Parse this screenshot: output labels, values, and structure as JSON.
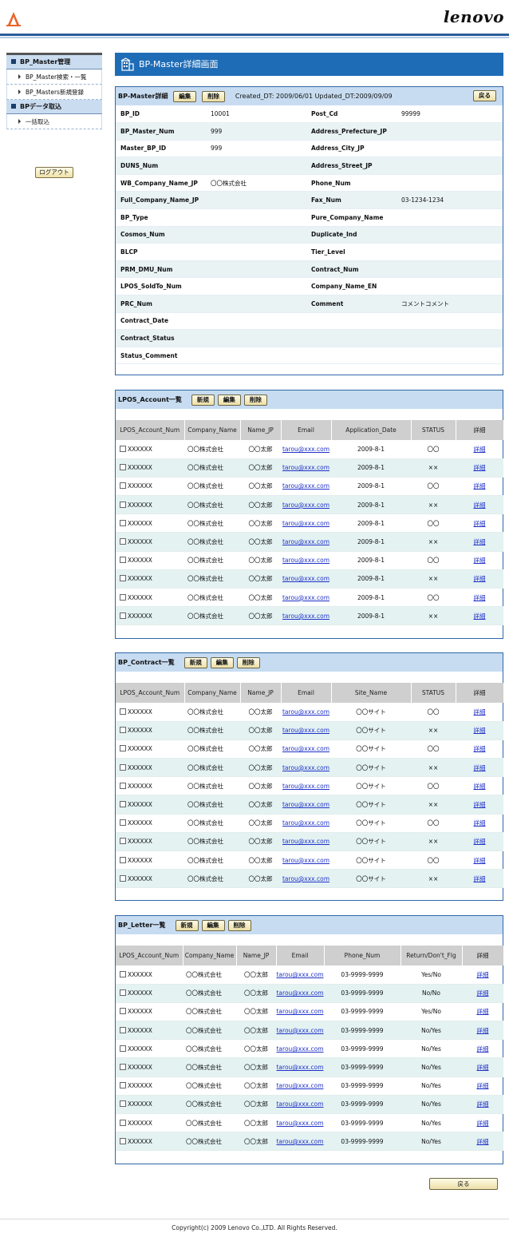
{
  "header": {
    "brand": "lenovo"
  },
  "sidebar": {
    "sections": [
      {
        "title": "BP_Master管理",
        "items": [
          "BP_Master検索・一覧",
          "BP_Masters新規登録"
        ]
      },
      {
        "title": "BPデータ取込",
        "items": [
          "一括取込"
        ]
      }
    ],
    "logout_label": "ログアウト"
  },
  "page_title": "BP-Master詳細画面",
  "detail": {
    "title": "BP-Master詳細",
    "edit_label": "編集",
    "delete_label": "削除",
    "meta": "Created_DT: 2009/06/01  Updated_DT:2009/09/09",
    "back_label": "戻る",
    "rows": [
      {
        "l1": "BP_ID",
        "v1": "10001",
        "l2": "Post_Cd",
        "v2": "99999"
      },
      {
        "l1": "BP_Master_Num",
        "v1": "999",
        "l2": "Address_Prefecture_JP",
        "v2": ""
      },
      {
        "l1": "Master_BP_ID",
        "v1": "999",
        "l2": "Address_City_JP",
        "v2": ""
      },
      {
        "l1": "DUNS_Num",
        "v1": "",
        "l2": "Address_Street_JP",
        "v2": ""
      },
      {
        "l1": "WB_Company_Name_JP",
        "v1": "〇〇株式会社",
        "l2": "Phone_Num",
        "v2": ""
      },
      {
        "l1": "Full_Company_Name_JP",
        "v1": "",
        "l2": "Fax_Num",
        "v2": "03-1234-1234"
      },
      {
        "l1": "BP_Type",
        "v1": "",
        "l2": "Pure_Company_Name",
        "v2": ""
      },
      {
        "l1": "Cosmos_Num",
        "v1": "",
        "l2": "Duplicate_Ind",
        "v2": ""
      },
      {
        "l1": "BLCP",
        "v1": "",
        "l2": "Tier_Level",
        "v2": ""
      },
      {
        "l1": "PRM_DMU_Num",
        "v1": "",
        "l2": "Contract_Num",
        "v2": ""
      },
      {
        "l1": "LPOS_SoldTo_Num",
        "v1": "",
        "l2": "Company_Name_EN",
        "v2": ""
      },
      {
        "l1": "PRC_Num",
        "v1": "",
        "l2": "Comment",
        "v2": "コメントコメント"
      },
      {
        "l1": "Contract_Date",
        "v1": "",
        "l2": "",
        "v2": ""
      },
      {
        "l1": "Contract_Status",
        "v1": "",
        "l2": "",
        "v2": ""
      },
      {
        "l1": "Status_Comment",
        "v1": "",
        "l2": "",
        "v2": ""
      }
    ]
  },
  "lists": [
    {
      "title": "LPOS_Account一覧",
      "buttons": [
        "新規",
        "編集",
        "削除"
      ],
      "columns": [
        "LPOS_Account_Num",
        "Company_Name",
        "Name_JP",
        "Email",
        "Application_Date",
        "STATUS",
        "詳細"
      ],
      "widths": [
        86,
        70,
        51,
        63,
        100,
        56,
        60
      ],
      "rows": [
        [
          "XXXXXX",
          "〇〇株式会社",
          "〇〇太郎",
          "tarou@xxx.com",
          "2009-8-1",
          "〇〇",
          "詳細"
        ],
        [
          "XXXXXX",
          "〇〇株式会社",
          "〇〇太郎",
          "tarou@xxx.com",
          "2009-8-1",
          "××",
          "詳細"
        ],
        [
          "XXXXXX",
          "〇〇株式会社",
          "〇〇太郎",
          "tarou@xxx.com",
          "2009-8-1",
          "〇〇",
          "詳細"
        ],
        [
          "XXXXXX",
          "〇〇株式会社",
          "〇〇太郎",
          "tarou@xxx.com",
          "2009-8-1",
          "××",
          "詳細"
        ],
        [
          "XXXXXX",
          "〇〇株式会社",
          "〇〇太郎",
          "tarou@xxx.com",
          "2009-8-1",
          "〇〇",
          "詳細"
        ],
        [
          "XXXXXX",
          "〇〇株式会社",
          "〇〇太郎",
          "tarou@xxx.com",
          "2009-8-1",
          "××",
          "詳細"
        ],
        [
          "XXXXXX",
          "〇〇株式会社",
          "〇〇太郎",
          "tarou@xxx.com",
          "2009-8-1",
          "〇〇",
          "詳細"
        ],
        [
          "XXXXXX",
          "〇〇株式会社",
          "〇〇太郎",
          "tarou@xxx.com",
          "2009-8-1",
          "××",
          "詳細"
        ],
        [
          "XXXXXX",
          "〇〇株式会社",
          "〇〇太郎",
          "tarou@xxx.com",
          "2009-8-1",
          "〇〇",
          "詳細"
        ],
        [
          "XXXXXX",
          "〇〇株式会社",
          "〇〇太郎",
          "tarou@xxx.com",
          "2009-8-1",
          "××",
          "詳細"
        ]
      ]
    },
    {
      "title": "BP_Contract一覧",
      "buttons": [
        "新規",
        "編集",
        "削除"
      ],
      "columns": [
        "LPOS_Account_Num",
        "Company_Name",
        "Name_JP",
        "Email",
        "Site_Name",
        "STATUS",
        "詳細"
      ],
      "widths": [
        86,
        70,
        51,
        63,
        100,
        56,
        60
      ],
      "rows": [
        [
          "XXXXXX",
          "〇〇株式会社",
          "〇〇太郎",
          "tarou@xxx.com",
          "〇〇サイト",
          "〇〇",
          "詳細"
        ],
        [
          "XXXXXX",
          "〇〇株式会社",
          "〇〇太郎",
          "tarou@xxx.com",
          "〇〇サイト",
          "××",
          "詳細"
        ],
        [
          "XXXXXX",
          "〇〇株式会社",
          "〇〇太郎",
          "tarou@xxx.com",
          "〇〇サイト",
          "〇〇",
          "詳細"
        ],
        [
          "XXXXXX",
          "〇〇株式会社",
          "〇〇太郎",
          "tarou@xxx.com",
          "〇〇サイト",
          "××",
          "詳細"
        ],
        [
          "XXXXXX",
          "〇〇株式会社",
          "〇〇太郎",
          "tarou@xxx.com",
          "〇〇サイト",
          "〇〇",
          "詳細"
        ],
        [
          "XXXXXX",
          "〇〇株式会社",
          "〇〇太郎",
          "tarou@xxx.com",
          "〇〇サイト",
          "××",
          "詳細"
        ],
        [
          "XXXXXX",
          "〇〇株式会社",
          "〇〇太郎",
          "tarou@xxx.com",
          "〇〇サイト",
          "〇〇",
          "詳細"
        ],
        [
          "XXXXXX",
          "〇〇株式会社",
          "〇〇太郎",
          "tarou@xxx.com",
          "〇〇サイト",
          "××",
          "詳細"
        ],
        [
          "XXXXXX",
          "〇〇株式会社",
          "〇〇太郎",
          "tarou@xxx.com",
          "〇〇サイト",
          "〇〇",
          "詳細"
        ],
        [
          "XXXXXX",
          "〇〇株式会社",
          "〇〇太郎",
          "tarou@xxx.com",
          "〇〇サイト",
          "××",
          "詳細"
        ]
      ]
    },
    {
      "title": "BP_Letter一覧",
      "buttons": [
        "新規",
        "編集",
        "削除"
      ],
      "columns": [
        "LPOS_Account_Num",
        "Company_Name",
        "Name_JP",
        "Email",
        "Phone_Num",
        "Return/Don't_Flg",
        "詳細"
      ],
      "widths": [
        84,
        67,
        50,
        60,
        96,
        77,
        52
      ],
      "rows": [
        [
          "XXXXXX",
          "〇〇株式会社",
          "〇〇太郎",
          "tarou@xxx.com",
          "03-9999-9999",
          "Yes/No",
          "詳細"
        ],
        [
          "XXXXXX",
          "〇〇株式会社",
          "〇〇太郎",
          "tarou@xxx.com",
          "03-9999-9999",
          "No/No",
          "詳細"
        ],
        [
          "XXXXXX",
          "〇〇株式会社",
          "〇〇太郎",
          "tarou@xxx.com",
          "03-9999-9999",
          "Yes/No",
          "詳細"
        ],
        [
          "XXXXXX",
          "〇〇株式会社",
          "〇〇太郎",
          "tarou@xxx.com",
          "03-9999-9999",
          "No/Yes",
          "詳細"
        ],
        [
          "XXXXXX",
          "〇〇株式会社",
          "〇〇太郎",
          "tarou@xxx.com",
          "03-9999-9999",
          "No/Yes",
          "詳細"
        ],
        [
          "XXXXXX",
          "〇〇株式会社",
          "〇〇太郎",
          "tarou@xxx.com",
          "03-9999-9999",
          "No/Yes",
          "詳細"
        ],
        [
          "XXXXXX",
          "〇〇株式会社",
          "〇〇太郎",
          "tarou@xxx.com",
          "03-9999-9999",
          "No/Yes",
          "詳細"
        ],
        [
          "XXXXXX",
          "〇〇株式会社",
          "〇〇太郎",
          "tarou@xxx.com",
          "03-9999-9999",
          "No/Yes",
          "詳細"
        ],
        [
          "XXXXXX",
          "〇〇株式会社",
          "〇〇太郎",
          "tarou@xxx.com",
          "03-9999-9999",
          "No/Yes",
          "詳細"
        ],
        [
          "XXXXXX",
          "〇〇株式会社",
          "〇〇太郎",
          "tarou@xxx.com",
          "03-9999-9999",
          "No/Yes",
          "詳細"
        ]
      ]
    }
  ],
  "bottom_back_label": "戻る",
  "copyright": "Copyright(c) 2009 Lenovo Co.,LTD. All Rights Reserved."
}
